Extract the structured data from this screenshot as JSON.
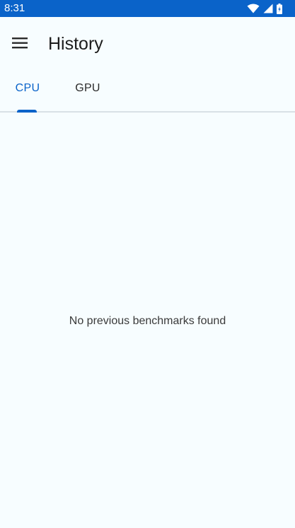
{
  "status_bar": {
    "time": "8:31",
    "icons": [
      "wifi-icon",
      "cellular-signal-icon",
      "battery-icon"
    ]
  },
  "app_bar": {
    "title": "History",
    "menu_icon": "menu-icon"
  },
  "tabs": [
    {
      "label": "CPU",
      "selected": true
    },
    {
      "label": "GPU",
      "selected": false
    }
  ],
  "content": {
    "empty_message": "No previous benchmarks found"
  },
  "colors": {
    "accent": "#0a63c9",
    "background": "#f7fdff",
    "status_bar": "#0a63c9"
  }
}
